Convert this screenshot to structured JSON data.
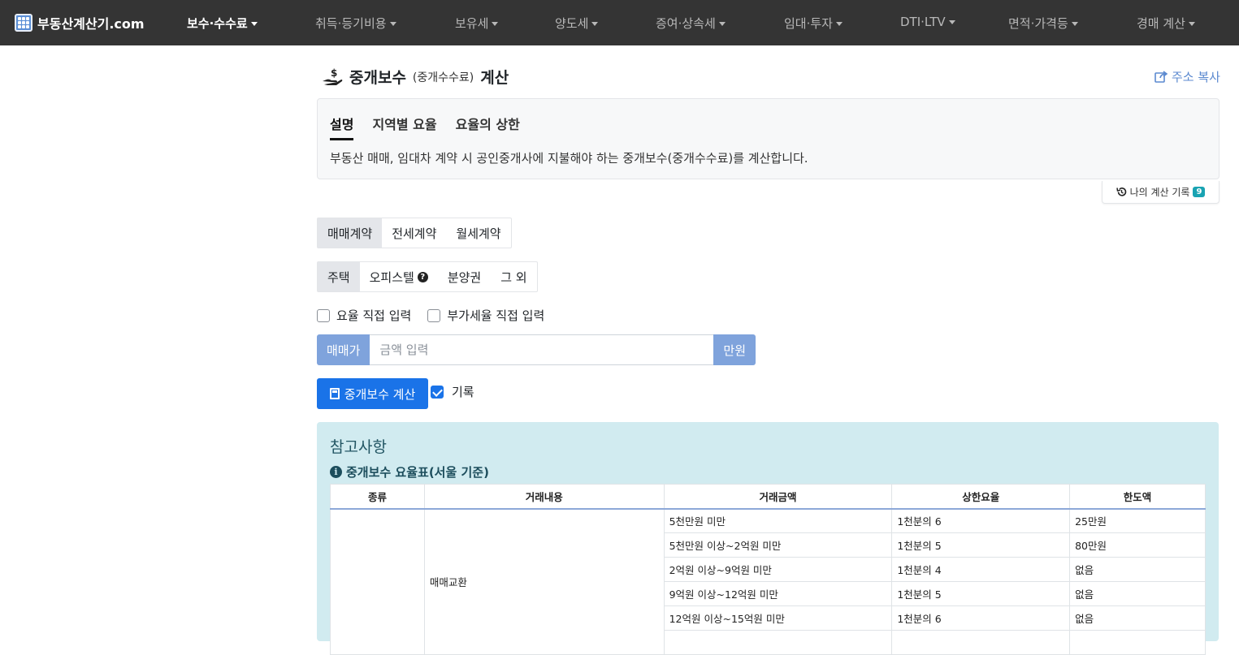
{
  "brand": {
    "name": "부동산계산기.com",
    "icon": "calculator-icon"
  },
  "nav": [
    {
      "label": "보수·수수료",
      "active": true
    },
    {
      "label": "취득·등기비용"
    },
    {
      "label": "보유세"
    },
    {
      "label": "양도세"
    },
    {
      "label": "증여·상속세"
    },
    {
      "label": "임대·투자"
    },
    {
      "label": "DTI·LTV"
    },
    {
      "label": "면적·가격등"
    },
    {
      "label": "경매 계산"
    }
  ],
  "header": {
    "title_main": "중개보수",
    "title_sub": "(중개수수료)",
    "title_end": "계산",
    "share_label": "주소 복사"
  },
  "info": {
    "tabs": [
      "설명",
      "지역별 요율",
      "요율의 상한"
    ],
    "description": "부동산 매매, 임대차 계약 시 공인중개사에 지불해야 하는 중개보수(중개수수료)를 계산합니다."
  },
  "history": {
    "label": "나의 계산 기록",
    "count": "9"
  },
  "contract_types": [
    "매매계약",
    "전세계약",
    "월세계약"
  ],
  "property_types": [
    "주택",
    "오피스텔",
    "분양권",
    "그 외"
  ],
  "options": {
    "rate_manual": "요율 직접 입력",
    "vat_manual": "부가세율 직접 입력"
  },
  "price_input": {
    "prefix": "매매가",
    "placeholder": "금액 입력",
    "suffix": "만원"
  },
  "calc_button": "중개보수 계산",
  "record_label": "기록",
  "reference": {
    "title": "참고사항",
    "subtitle": "중개보수 요율표(서울 기준)",
    "columns": [
      "종류",
      "거래내용",
      "거래금액",
      "상한요율",
      "한도액"
    ],
    "deal_type": "매매교환",
    "rows": [
      {
        "amount": "5천만원 미만",
        "rate": "1천분의 6",
        "limit": "25만원"
      },
      {
        "amount": "5천만원 이상~2억원 미만",
        "rate": "1천분의 5",
        "limit": "80만원"
      },
      {
        "amount": "2억원 이상~9억원 미만",
        "rate": "1천분의 4",
        "limit": "없음"
      },
      {
        "amount": "9억원 이상~12억원 미만",
        "rate": "1천분의 5",
        "limit": "없음"
      },
      {
        "amount": "12억원 이상~15억원 미만",
        "rate": "1천분의 6",
        "limit": "없음"
      }
    ]
  },
  "colors": {
    "navbar": "#343434",
    "primary": "#1a73e8",
    "addon": "#7fa3dc",
    "panel": "#d1ebf0"
  }
}
